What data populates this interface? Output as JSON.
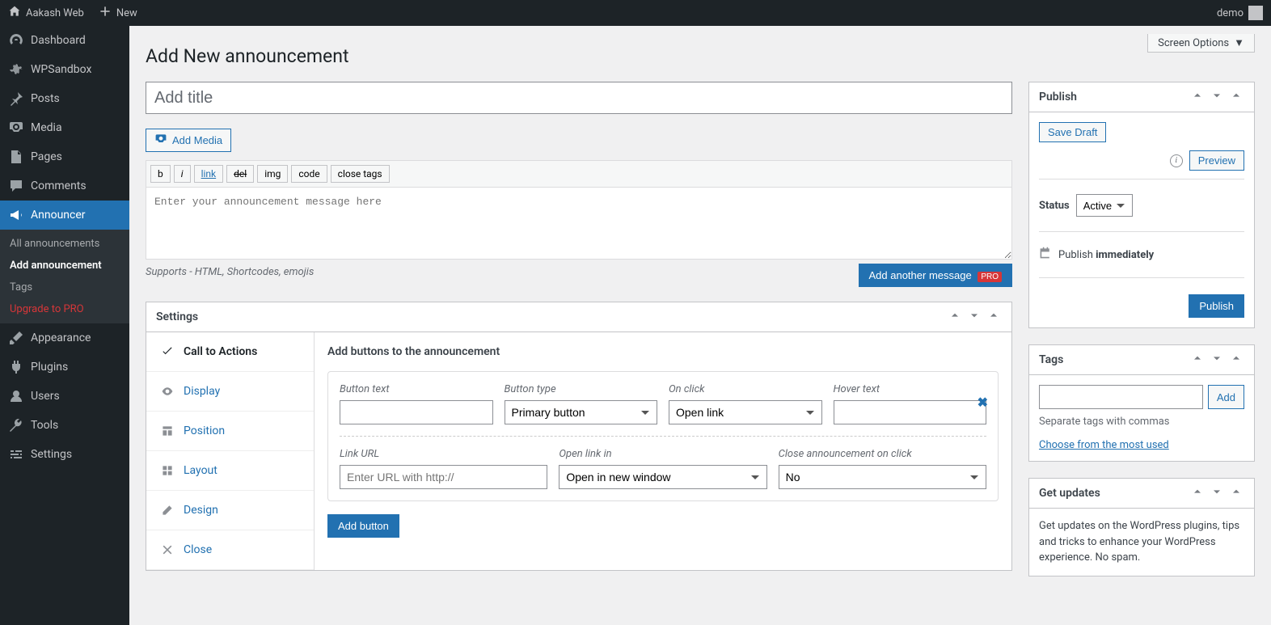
{
  "adminbar": {
    "site_name": "Aakash Web",
    "new_label": "New",
    "user": "demo"
  },
  "sidebar": {
    "items": [
      {
        "label": "Dashboard"
      },
      {
        "label": "WPSandbox"
      },
      {
        "label": "Posts"
      },
      {
        "label": "Media"
      },
      {
        "label": "Pages"
      },
      {
        "label": "Comments"
      },
      {
        "label": "Announcer"
      },
      {
        "label": "Appearance"
      },
      {
        "label": "Plugins"
      },
      {
        "label": "Users"
      },
      {
        "label": "Tools"
      },
      {
        "label": "Settings"
      }
    ],
    "submenu": [
      {
        "label": "All announcements"
      },
      {
        "label": "Add announcement"
      },
      {
        "label": "Tags"
      },
      {
        "label": "Upgrade to PRO"
      }
    ]
  },
  "screen_options": "Screen Options",
  "page_title": "Add New announcement",
  "title_placeholder": "Add title",
  "add_media": "Add Media",
  "editor_buttons": [
    "b",
    "i",
    "link",
    "del",
    "img",
    "code",
    "close tags"
  ],
  "editor_placeholder": "Enter your announcement message here",
  "editor_hint": "Supports - HTML, Shortcodes, emojis",
  "add_another": "Add another message",
  "pro_badge": "PRO",
  "settings": {
    "title": "Settings",
    "tabs": [
      {
        "label": "Call to Actions"
      },
      {
        "label": "Display"
      },
      {
        "label": "Position"
      },
      {
        "label": "Layout"
      },
      {
        "label": "Design"
      },
      {
        "label": "Close"
      }
    ],
    "content_title": "Add buttons to the announcement",
    "fields": {
      "button_text": "Button text",
      "button_type": "Button type",
      "button_type_value": "Primary button",
      "on_click": "On click",
      "on_click_value": "Open link",
      "hover_text": "Hover text",
      "link_url": "Link URL",
      "link_url_placeholder": "Enter URL with http://",
      "open_in": "Open link in",
      "open_in_value": "Open in new window",
      "close_on_click": "Close announcement on click",
      "close_on_click_value": "No"
    },
    "add_button": "Add button"
  },
  "publish": {
    "title": "Publish",
    "save_draft": "Save Draft",
    "preview": "Preview",
    "status_label": "Status",
    "status_value": "Active",
    "schedule_prefix": "Publish",
    "schedule_value": "immediately",
    "publish_btn": "Publish"
  },
  "tags": {
    "title": "Tags",
    "add": "Add",
    "hint": "Separate tags with commas",
    "choose": "Choose from the most used"
  },
  "updates": {
    "title": "Get updates",
    "text": "Get updates on the WordPress plugins, tips and tricks to enhance your WordPress experience. No spam."
  }
}
